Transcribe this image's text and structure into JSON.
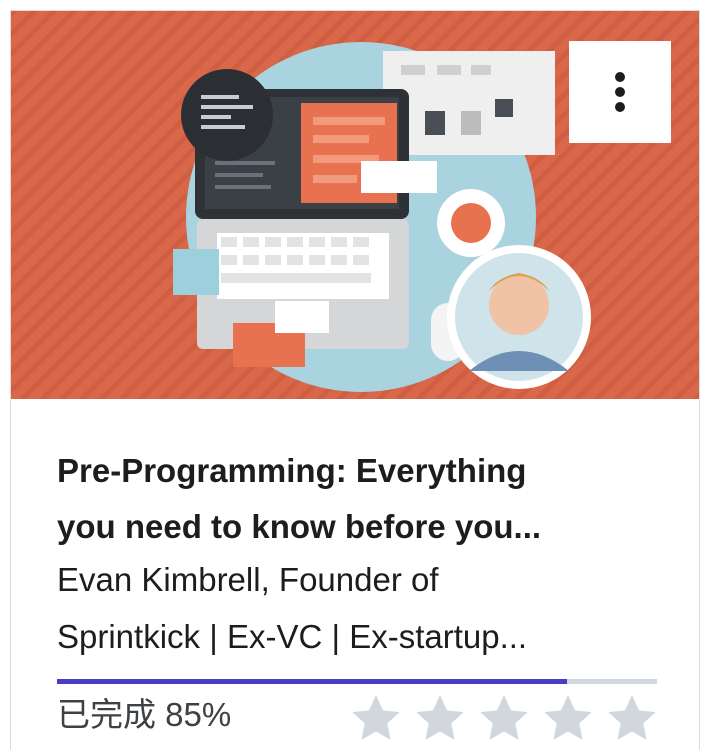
{
  "course": {
    "title_line1": "Pre-Programming: Everything",
    "title_line2": "you need to know before you...",
    "instructor_line1": "Evan Kimbrell, Founder of",
    "instructor_line2": "Sprintkick | Ex-VC | Ex-startup...",
    "thumbnail_icon": "course-thumbnail-illustration",
    "menu_icon": "vertical-ellipsis-icon"
  },
  "progress": {
    "label": "已完成 85%",
    "fraction": 0.85
  },
  "rating": {
    "stars_total": 5,
    "stars_filled": 0
  },
  "colors": {
    "thumbnail_bg": "#d9674a",
    "progress_fill": "#4a3cc6",
    "progress_track": "#d1d7dc",
    "star_empty": "#d1d7dc",
    "text": "#1c1d1f"
  }
}
